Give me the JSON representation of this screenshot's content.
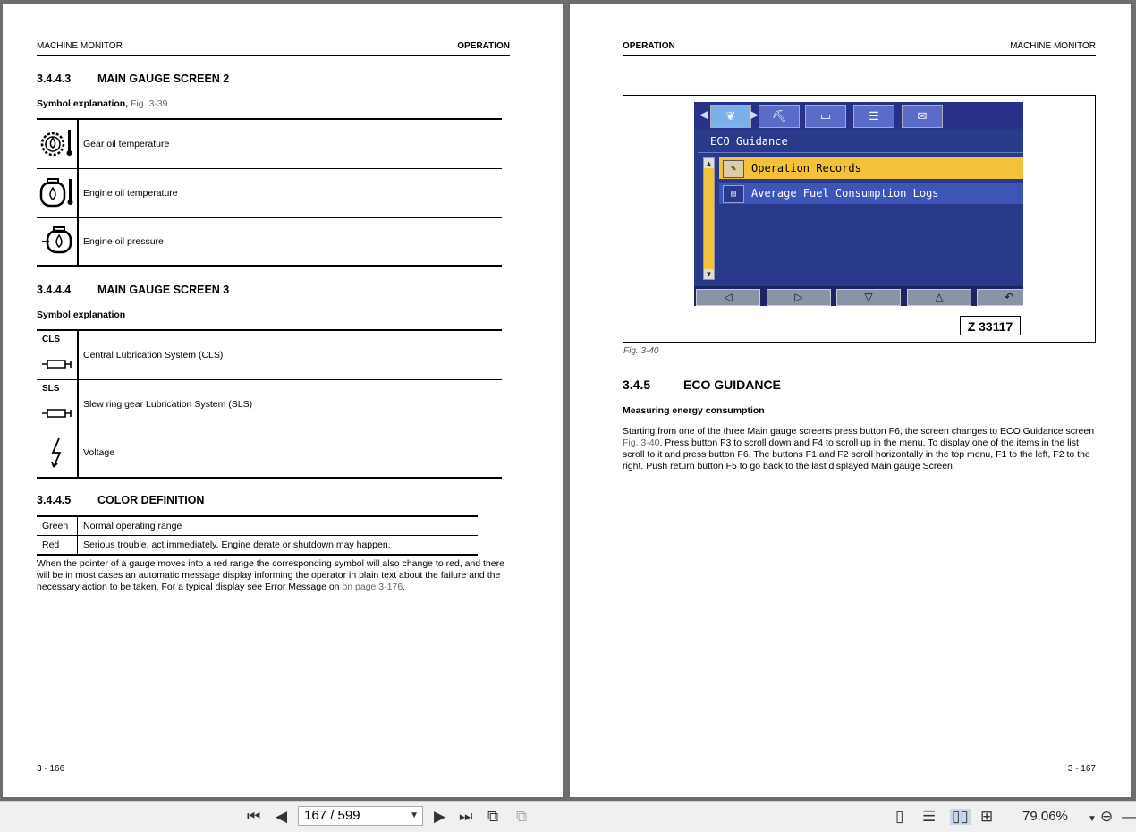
{
  "left_page": {
    "header_left": "MACHINE MONITOR",
    "header_right": "OPERATION",
    "sec1": {
      "num": "3.4.4.3",
      "title": "MAIN GAUGE SCREEN 2"
    },
    "sec1_sub": "Symbol explanation,",
    "sec1_ref": "Fig. 3-39",
    "table1": [
      {
        "label": "Gear oil temperature"
      },
      {
        "label": "Engine oil temperature"
      },
      {
        "label": "Engine oil pressure"
      }
    ],
    "sec2": {
      "num": "3.4.4.4",
      "title": "MAIN GAUGE SCREEN 3"
    },
    "sec2_sub": "Symbol explanation",
    "table2": [
      {
        "code": "CLS",
        "label": "Central Lubrication System (CLS)"
      },
      {
        "code": "SLS",
        "label": "Slew ring gear Lubrication System (SLS)"
      },
      {
        "code": "",
        "label": "Voltage"
      }
    ],
    "sec3": {
      "num": "3.4.4.5",
      "title": "COLOR DEFINITION"
    },
    "colors": [
      {
        "name": "Green",
        "desc": "Normal operating range"
      },
      {
        "name": "Red",
        "desc": "Serious trouble, act immediately. Engine derate or shutdown may happen."
      }
    ],
    "para_main": "When the pointer of a gauge moves into a red range the corresponding symbol will also change to red, and there will be in most cases an automatic message display informing the operator in plain text about the failure and the necessary action to be taken. For a typical display see Error Message on",
    "para_link": "on page 3-176",
    "para_end": ".",
    "page_number": "3 - 166"
  },
  "right_page": {
    "header_left": "OPERATION",
    "header_right": "MACHINE MONITOR",
    "screen": {
      "title": "ECO Guidance",
      "items": [
        {
          "label": "Operation Records",
          "selected": true
        },
        {
          "label": "Average Fuel Consumption Logs",
          "selected": false
        }
      ],
      "tab_icons": [
        "leaf-icon",
        "excavator-icon",
        "monitor-icon",
        "list-icon",
        "mail-icon"
      ]
    },
    "fig_id": "Z 33117",
    "fig_caption": "Fig. 3-40",
    "sec": {
      "num": "3.4.5",
      "title": "ECO GUIDANCE"
    },
    "sub": "Measuring energy consumption",
    "para_a": "Starting from one of the three Main gauge screens press button F6, the screen changes to ECO Guidance screen",
    "para_ref": "Fig. 3-40",
    "para_b": ". Press button F3 to scroll down and F4 to scroll up in the menu. To display one of the items in the list scroll to it and press button F6. The buttons F1 and F2 scroll horizontally in the top menu, F1 to the left, F2 to the right. Push return button F5 to go back to the last displayed Main gauge Screen.",
    "page_number": "3 - 167"
  },
  "toolbar": {
    "page_value": "167 / 599",
    "zoom": "79.06%"
  },
  "colors": {
    "viewer_bg": "#6d6d6d",
    "screen_bg": "#2a3a8a",
    "highlight": "#f3c23a"
  }
}
